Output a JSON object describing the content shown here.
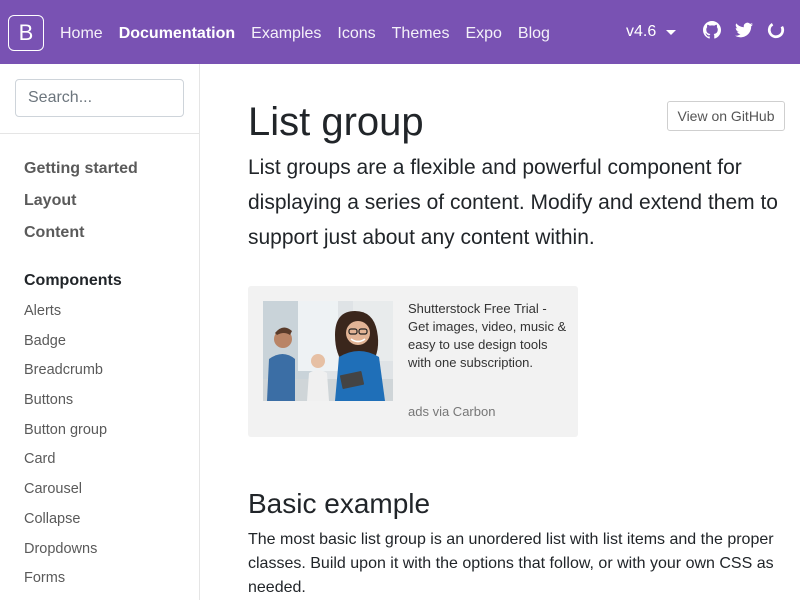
{
  "navbar": {
    "brand": "B",
    "links": [
      "Home",
      "Documentation",
      "Examples",
      "Icons",
      "Themes",
      "Expo",
      "Blog"
    ],
    "active_index": 1,
    "version": "v4.6",
    "bg_color": "#7952b3",
    "icons": [
      "github-icon",
      "twitter-icon",
      "opencollective-icon"
    ]
  },
  "sidebar": {
    "search_placeholder": "Search...",
    "top_items": [
      "Getting started",
      "Layout",
      "Content"
    ],
    "components_title": "Components",
    "component_items": [
      "Alerts",
      "Badge",
      "Breadcrumb",
      "Buttons",
      "Button group",
      "Card",
      "Carousel",
      "Collapse",
      "Dropdowns",
      "Forms"
    ]
  },
  "main": {
    "title": "List group",
    "github_button": "View on GitHub",
    "lead": "List groups are a flexible and powerful component for displaying a series of content. Modify and extend them to support just about any content within.",
    "ad": {
      "text": "Shutterstock Free Trial - Get images, video, music & easy to use design tools with one subscription.",
      "via": "ads via Carbon"
    },
    "section_title": "Basic example",
    "section_text": "The most basic list group is an unordered list with list items and the proper classes. Build upon it with the options that follow, or with your own CSS as needed."
  }
}
